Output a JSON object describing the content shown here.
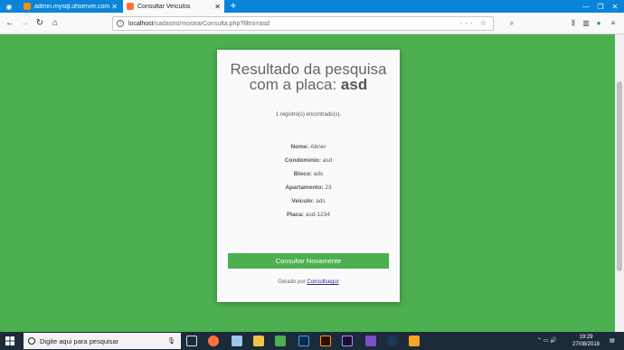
{
  "browser": {
    "tabs": [
      {
        "title": "admin.mysql.uhserver.com / n...",
        "favicon_color": "#f29111",
        "active": false
      },
      {
        "title": "Consultar Veículos",
        "favicon_color": "#ff7139",
        "active": true
      }
    ],
    "url_host": "localhost",
    "url_path": "/cadastro/mostrarConsulta.php?filtro=asd"
  },
  "page": {
    "heading_line1": "Resultado da pesquisa",
    "heading_line2_prefix": "com a placa: ",
    "heading_plate": "asd",
    "count_text": "1 registro(s) encontrado(s).",
    "fields": [
      {
        "label": "Nome:",
        "value": "Abner"
      },
      {
        "label": "Condominio:",
        "value": "asd"
      },
      {
        "label": "Bloco:",
        "value": "ads"
      },
      {
        "label": "Apartamento:",
        "value": "23"
      },
      {
        "label": "Veiculo:",
        "value": "ads"
      },
      {
        "label": "Placa:",
        "value": "asd-1234"
      }
    ],
    "button_label": "Consultar Novamente",
    "footer_prefix": "Gerado por ",
    "footer_link": "Consultsegur"
  },
  "taskbar": {
    "search_placeholder": "Digite aqui para pesquisar",
    "time": "19:29",
    "date": "27/08/2018"
  },
  "colors": {
    "page_bg": "#4caf50",
    "button_bg": "#4caf50",
    "tabbar_bg": "#0a84d8",
    "taskbar_bg": "#1c2b3a"
  }
}
